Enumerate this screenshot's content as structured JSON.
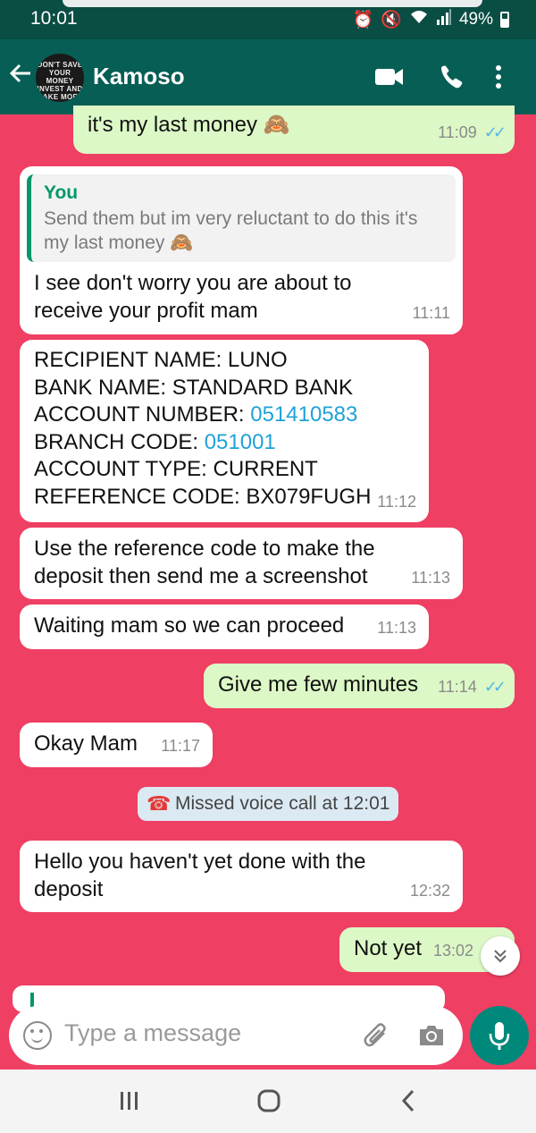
{
  "status": {
    "time": "10:01",
    "battery": "49%"
  },
  "header": {
    "contact_name": "Kamoso",
    "avatar_text": "DON'T SAVE YOUR MONEY INVEST AND MAKE MORE"
  },
  "messages": {
    "m0": {
      "text": "it's my last money 🙈",
      "time": "11:09"
    },
    "m1": {
      "quote_author": "You",
      "quote_text": "Send them but im very reluctant to do this it's my last money 🙈",
      "text": "I see don't worry you are about to receive your profit mam",
      "time": "11:11"
    },
    "m2": {
      "line1": "RECIPIENT NAME: LUNO",
      "line2": "BANK NAME: STANDARD BANK",
      "line3_label": "ACCOUNT NUMBER: ",
      "line3_value": "051410583",
      "line4_label": "BRANCH CODE: ",
      "line4_value": "051001",
      "line5": "ACCOUNT TYPE: CURRENT",
      "line6": "REFERENCE CODE: BX079FUGH",
      "time": "11:12"
    },
    "m3": {
      "text": "Use the reference code to make the deposit then send me a screenshot",
      "time": "11:13"
    },
    "m4": {
      "text": "Waiting mam so we can proceed",
      "time": "11:13"
    },
    "m5": {
      "text": "Give me few minutes",
      "time": "11:14"
    },
    "m6": {
      "text": "Okay Mam",
      "time": "11:17"
    },
    "system": {
      "text": "Missed voice call at 12:01"
    },
    "m7": {
      "text": "Hello you haven't yet done with the deposit",
      "time": "12:32"
    },
    "m8": {
      "text": "Not yet",
      "time": "13:02"
    }
  },
  "input": {
    "placeholder": "Type a message"
  },
  "colors": {
    "chat_bg": "#ef3f63",
    "header": "#075e54",
    "outgoing": "#dcf8c6",
    "incoming": "#ffffff",
    "accent": "#00897b"
  }
}
